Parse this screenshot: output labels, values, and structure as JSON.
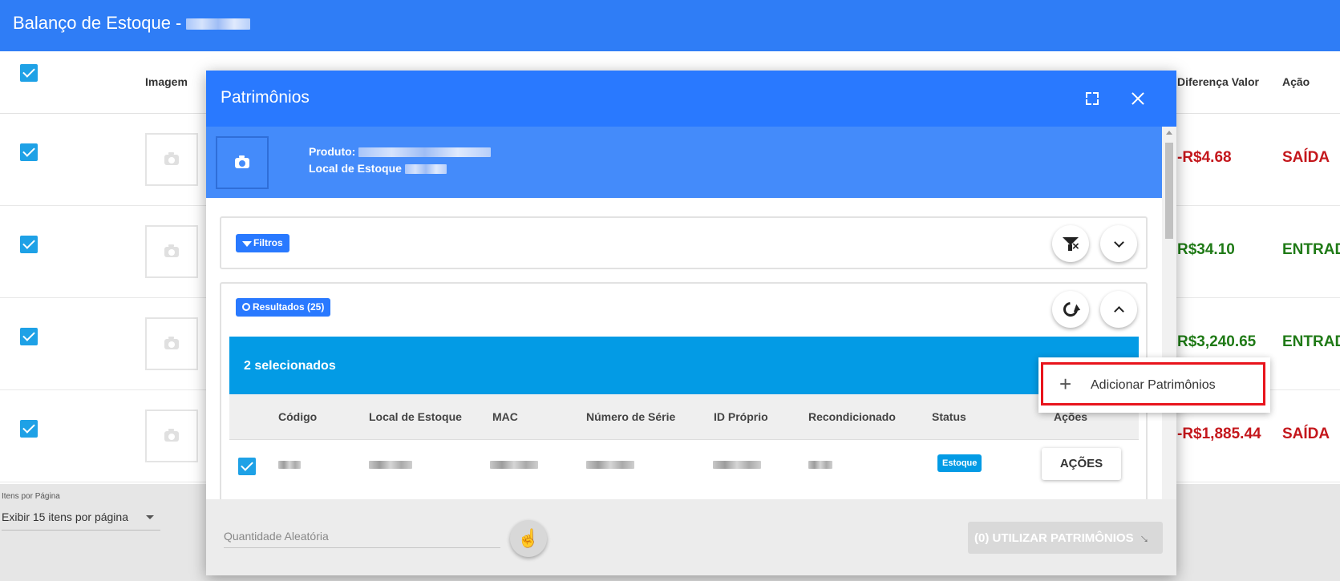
{
  "page": {
    "title": "Balanço de Estoque - "
  },
  "background_table": {
    "headers": {
      "image": "Imagem",
      "diff_value": "Diferença Valor",
      "action": "Ação"
    },
    "rows": [
      {
        "diff_value": "-R$4.68",
        "action": "SAÍDA",
        "color": "#c4171c"
      },
      {
        "diff_value": "R$34.10",
        "action": "ENTRAD",
        "color": "#1f7a16"
      },
      {
        "diff_value": "R$3,240.65",
        "action": "ENTRAD",
        "color": "#1f7a16"
      },
      {
        "diff_value": "-R$1,885.44",
        "action": "SAÍDA",
        "color": "#c4171c"
      }
    ]
  },
  "pagination": {
    "label": "Itens por Página",
    "selected": "Exibir 15 itens por página"
  },
  "modal": {
    "title": "Patrimônios",
    "product_label": "Produto:",
    "location_label": "Local de Estoque",
    "filters_label": "Filtros",
    "results_label": "Resultados (25)",
    "selected_text": "2 selecionados",
    "columns": [
      "Código",
      "Local de Estoque",
      "MAC",
      "Número de Série",
      "ID Próprio",
      "Recondicionado",
      "Status",
      "Ações"
    ],
    "row": {
      "status": "Estoque",
      "actions_button": "AÇÕES"
    },
    "footer": {
      "random_qty_label": "Quantidade Aleatória",
      "use_button": "(0) UTILIZAR PATRIMÔNIOS"
    }
  },
  "context_menu": {
    "items": [
      {
        "label": "Adicionar Patrimônios",
        "icon": "plus-icon"
      }
    ]
  },
  "colors": {
    "primary": "#2979ff",
    "topbar": "#2f7df6",
    "selection": "#039be5",
    "highlight": "#e8141c"
  }
}
